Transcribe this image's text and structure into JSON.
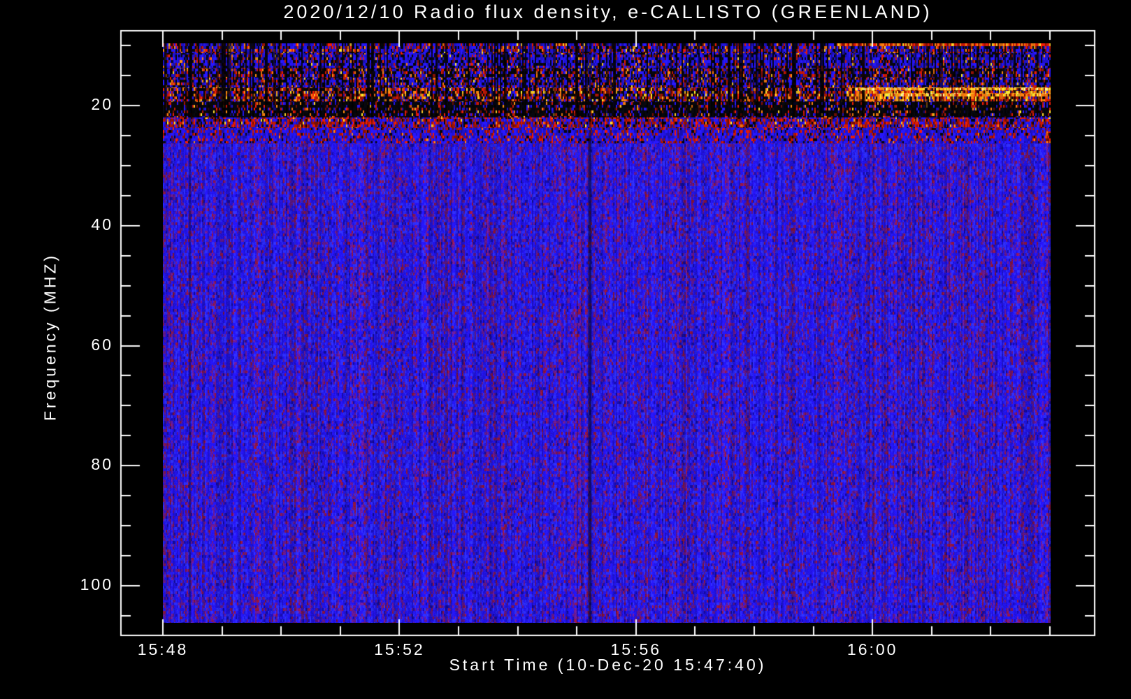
{
  "page": {
    "background": "#000000",
    "kind": "e-CALLISTO quicklook radio spectrogram"
  },
  "chart_data": {
    "type": "heatmap",
    "title": "2020/12/10  Radio flux density, e-CALLISTO (GREENLAND)",
    "xlabel": "Start Time (10-Dec-20 15:47:40)",
    "ylabel": "Frequency (MHZ)",
    "legend": "none",
    "grid": "off",
    "x_axis": {
      "unit": "minutes after 15:48 UT",
      "data_span_minutes": [
        0,
        15.0
      ],
      "axis_span_minutes": [
        -0.72,
        15.77
      ],
      "major_ticks": [
        {
          "t": 0,
          "label": "15:48"
        },
        {
          "t": 4,
          "label": "15:52"
        },
        {
          "t": 8,
          "label": "15:56"
        },
        {
          "t": 12,
          "label": "16:00"
        }
      ],
      "minor_ticks": [
        0,
        1,
        2,
        3,
        4,
        5,
        6,
        7,
        8,
        9,
        10,
        11,
        12,
        13,
        14,
        15
      ]
    },
    "y_axis": {
      "unit": "MHz",
      "inverted": true,
      "data_span_mhz": [
        9.6,
        106.1
      ],
      "axis_span_mhz": [
        7.4,
        108.4
      ],
      "major_ticks": [
        20,
        40,
        60,
        80,
        100
      ],
      "minor_ticks": [
        10,
        15,
        20,
        25,
        30,
        35,
        40,
        45,
        50,
        55,
        60,
        65,
        70,
        75,
        80,
        85,
        90,
        95,
        100,
        105
      ]
    },
    "data_summary": {
      "background_10_to_26MHz": "strong broadband interference and burst activity: blue/black striation with red-orange speckle bands",
      "narrowband_emission": "bright orange-yellow horizontal emission near 17-18.5 MHz, intensifying after ~15:59",
      "red_band": "reddish speckle band near 22-23.5 MHz across the full record",
      "background_26_to_106MHz": "quiet blue noise background with faint purple speckle and weak vertical striping",
      "dark_time_gaps_minutes": [
        0.45,
        4.35,
        7.22
      ]
    },
    "palette": {
      "axis": "#ffffff",
      "text": "#ffffff",
      "hot_black": "#07070c",
      "body_blue": "#2214e8",
      "body_blue_bright": "#2c2cff",
      "body_blue_dark": "#150ba0",
      "body_purple": "#64188c",
      "body_crimson": "#8c153c",
      "hot_red": "#cd1905",
      "hot_orange": "#ff7d0f",
      "hot_yellow": "#ffd228",
      "hot_pale": "#fff0a0"
    },
    "bands": [
      {
        "f0": 9.6,
        "f1": 11.2,
        "cv": true,
        "w": {
          "bk": 0.22,
          "bl": 0.48,
          "rd": 0.22,
          "or": 0.06,
          "yl": 0.02
        }
      },
      {
        "f0": 11.2,
        "f1": 13.6,
        "cv": true,
        "w": {
          "bk": 0.28,
          "bl": 0.58,
          "rd": 0.11,
          "or": 0.02,
          "yl": 0.01
        }
      },
      {
        "f0": 13.6,
        "f1": 15.3,
        "cv": true,
        "w": {
          "bk": 0.42,
          "bl": 0.32,
          "rd": 0.2,
          "or": 0.05,
          "yl": 0.01
        }
      },
      {
        "f0": 15.3,
        "f1": 16.9,
        "cv": true,
        "w": {
          "bk": 0.34,
          "bl": 0.42,
          "rd": 0.18,
          "or": 0.05,
          "yl": 0.01
        }
      },
      {
        "f0": 16.9,
        "f1": 19.3,
        "cv": true,
        "w": {
          "bk": 0.36,
          "bl": 0.2,
          "rd": 0.27,
          "or": 0.11,
          "yl": 0.06
        },
        "boost_t": 11.6,
        "boost_w": {
          "bk": 0.08,
          "bl": 0.1,
          "rd": 0.32,
          "or": 0.33,
          "yl": 0.17
        }
      },
      {
        "f0": 19.3,
        "f1": 21.9,
        "cv": true,
        "w": {
          "bk": 0.7,
          "bl": 0.14,
          "rd": 0.12,
          "or": 0.03,
          "yl": 0.01
        }
      },
      {
        "f0": 21.9,
        "f1": 23.7,
        "cv": false,
        "w": {
          "bk": 0.12,
          "bl": 0.42,
          "rd": 0.42,
          "or": 0.03,
          "yl": 0.01
        }
      },
      {
        "f0": 23.7,
        "f1": 26.2,
        "cv": false,
        "w": {
          "bk": 0.06,
          "bl": 0.7,
          "rd": 0.23,
          "or": 0.01,
          "yl": 0.0
        }
      }
    ],
    "streaks": [
      {
        "f0": 9.6,
        "f1": 10.1,
        "t0": 11.4,
        "t1": 15.05,
        "w": {
          "bk": 0.05,
          "bl": 0.0,
          "rd": 0.5,
          "or": 0.3,
          "yl": 0.15
        }
      },
      {
        "f0": 16.9,
        "f1": 17.35,
        "t0": 11.7,
        "t1": 15.05,
        "w": {
          "bk": 0.03,
          "bl": 0.0,
          "rd": 0.12,
          "or": 0.35,
          "yl": 0.35,
          "pa": 0.15
        }
      },
      {
        "f0": 17.9,
        "f1": 18.4,
        "t0": 12.2,
        "t1": 15.05,
        "w": {
          "bk": 0.05,
          "bl": 0.0,
          "rd": 0.18,
          "or": 0.35,
          "yl": 0.3,
          "pa": 0.12
        }
      },
      {
        "f0": 24.3,
        "f1": 27.5,
        "t0": 14.92,
        "t1": 15.05,
        "w": {
          "bk": 0.05,
          "bl": 0.0,
          "rd": 0.75,
          "or": 0.2,
          "yl": 0.0
        }
      }
    ],
    "body": {
      "f0": 26.2,
      "purple_base": 0.08,
      "purple_col": 0.38,
      "dark_frac": 0.06,
      "crimson_frac": 0.04
    },
    "dark_columns": [
      {
        "t": 0.45,
        "strength": 0.4,
        "width": 2
      },
      {
        "t": 4.35,
        "strength": 0.22,
        "width": 2
      },
      {
        "t": 7.22,
        "strength": 0.58,
        "width": 3
      }
    ]
  }
}
